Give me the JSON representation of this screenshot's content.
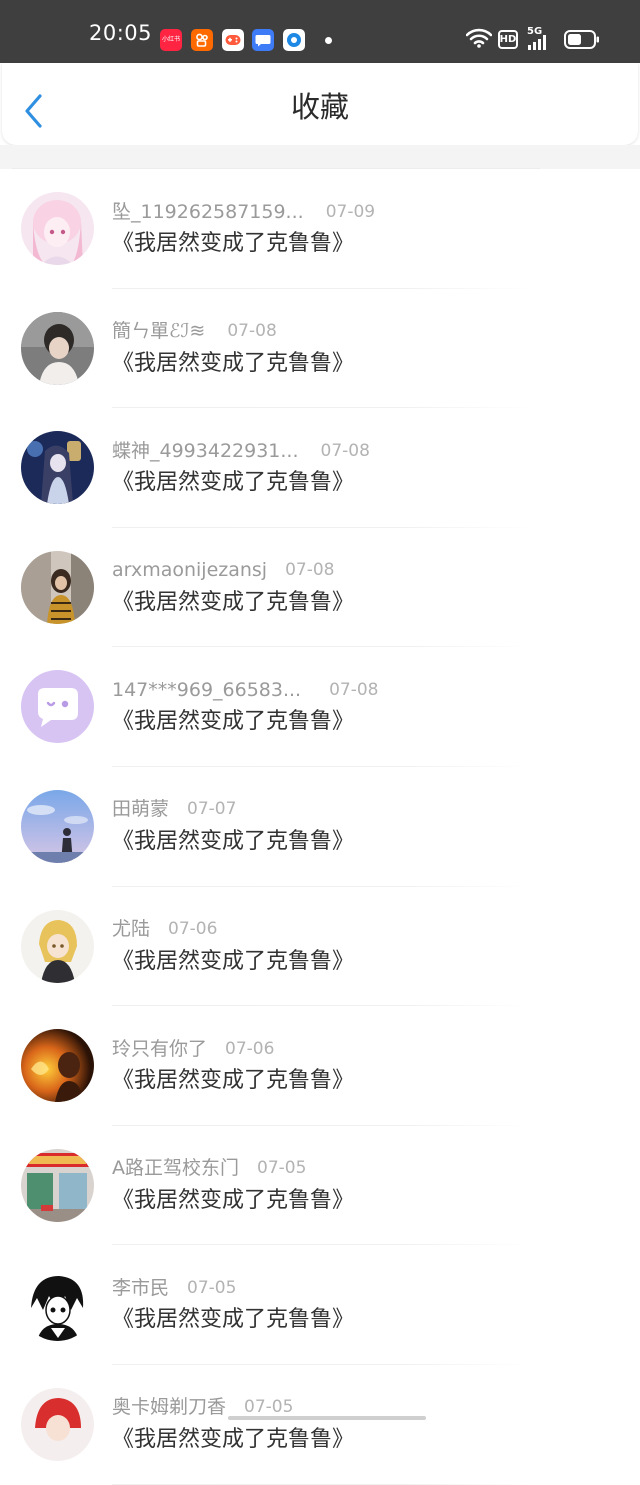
{
  "status_bar": {
    "time": "20:05",
    "app_icons": [
      {
        "name": "xiaohongshu-icon",
        "label": "小红书",
        "color": "#ff2442"
      },
      {
        "name": "kuaishou-icon",
        "label": "",
        "color": "#ff6a00"
      },
      {
        "name": "game-center-icon",
        "label": "",
        "color": "#ffffff"
      },
      {
        "name": "message-bubble-icon",
        "label": "",
        "color": "#3d7bf7"
      },
      {
        "name": "browser-icon",
        "label": "",
        "color": "#1e88e5"
      }
    ],
    "network": "5G",
    "hd_label": "HD"
  },
  "header": {
    "title": "收藏",
    "back_icon": "chevron-left-icon",
    "accent": "#2f8fe0"
  },
  "items": [
    {
      "username": "坠_119262587159...",
      "date": "07-09",
      "title": "《我居然变成了克鲁鲁》",
      "avatar_style": "pink-anime"
    },
    {
      "username": "簡ㄣ單ℰℐ≋",
      "date": "07-08",
      "title": "《我居然变成了克鲁鲁》",
      "avatar_style": "gray-portrait"
    },
    {
      "username": "蝶神_4993422931...",
      "date": "07-08",
      "title": "《我居然变成了克鲁鲁》",
      "avatar_style": "blue-night"
    },
    {
      "username": "arxmaonijezansj",
      "date": "07-08",
      "title": "《我居然变成了克鲁鲁》",
      "avatar_style": "outdoor-photo"
    },
    {
      "username": "147***969_66583...",
      "date": "07-08",
      "title": "《我居然变成了克鲁鲁》",
      "avatar_style": "purple-default"
    },
    {
      "username": "田萌蒙",
      "date": "07-07",
      "title": "《我居然变成了克鲁鲁》",
      "avatar_style": "sky-photo"
    },
    {
      "username": "尤陆",
      "date": "07-06",
      "title": "《我居然变成了克鲁鲁》",
      "avatar_style": "blonde-anime"
    },
    {
      "username": "玲只有你了",
      "date": "07-06",
      "title": "《我居然变成了克鲁鲁》",
      "avatar_style": "orange-glow"
    },
    {
      "username": "A路正驾校东门",
      "date": "07-05",
      "title": "《我居然变成了克鲁鲁》",
      "avatar_style": "storefront-photo"
    },
    {
      "username": "李市民",
      "date": "07-05",
      "title": "《我居然变成了克鲁鲁》",
      "avatar_style": "manga-bw"
    },
    {
      "username": "奥卡姆剃刀香",
      "date": "07-05",
      "title": "《我居然变成了克鲁鲁》",
      "avatar_style": "red-hair-anime"
    }
  ]
}
